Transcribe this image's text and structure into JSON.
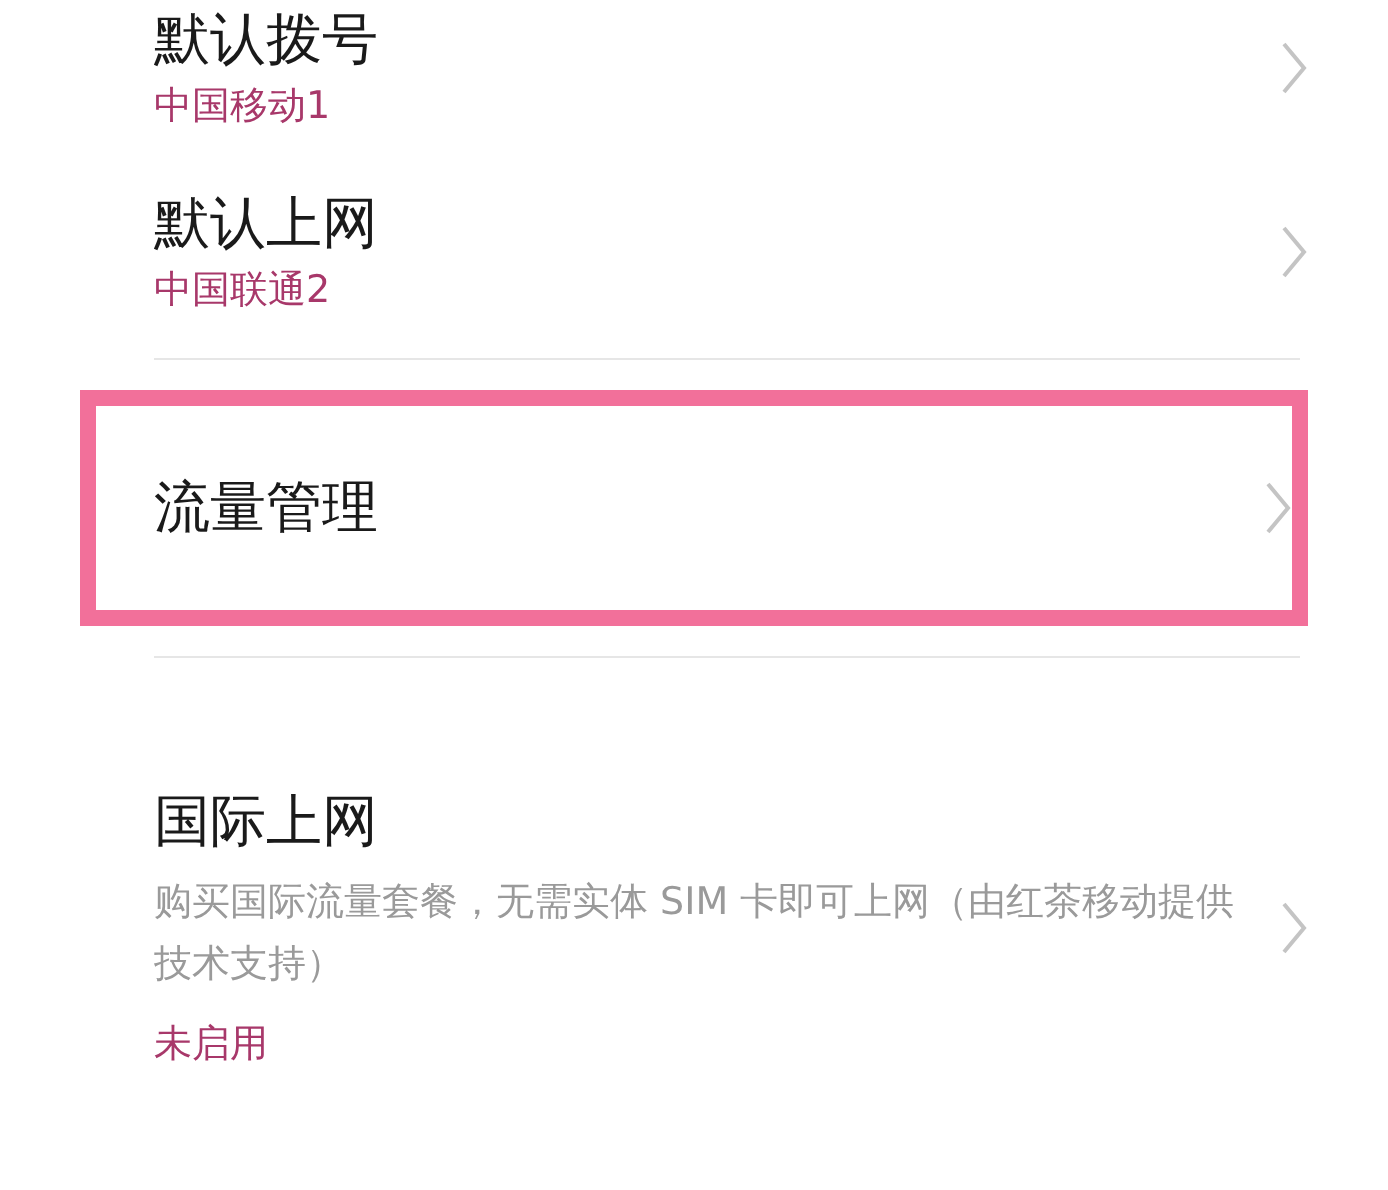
{
  "groups": [
    {
      "items": [
        {
          "title": "默认拨号",
          "subtitle": "中国移动1",
          "highlighted": false
        },
        {
          "title": "默认上网",
          "subtitle": "中国联通2",
          "highlighted": false
        }
      ]
    },
    {
      "items": [
        {
          "title": "流量管理",
          "highlighted": true
        }
      ]
    },
    {
      "items": [
        {
          "title": "国际上网",
          "description": "购买国际流量套餐，无需实体 SIM 卡即可上网（由红茶移动提供技术支持）",
          "subtitle": "未启用",
          "highlighted": false
        }
      ]
    }
  ]
}
